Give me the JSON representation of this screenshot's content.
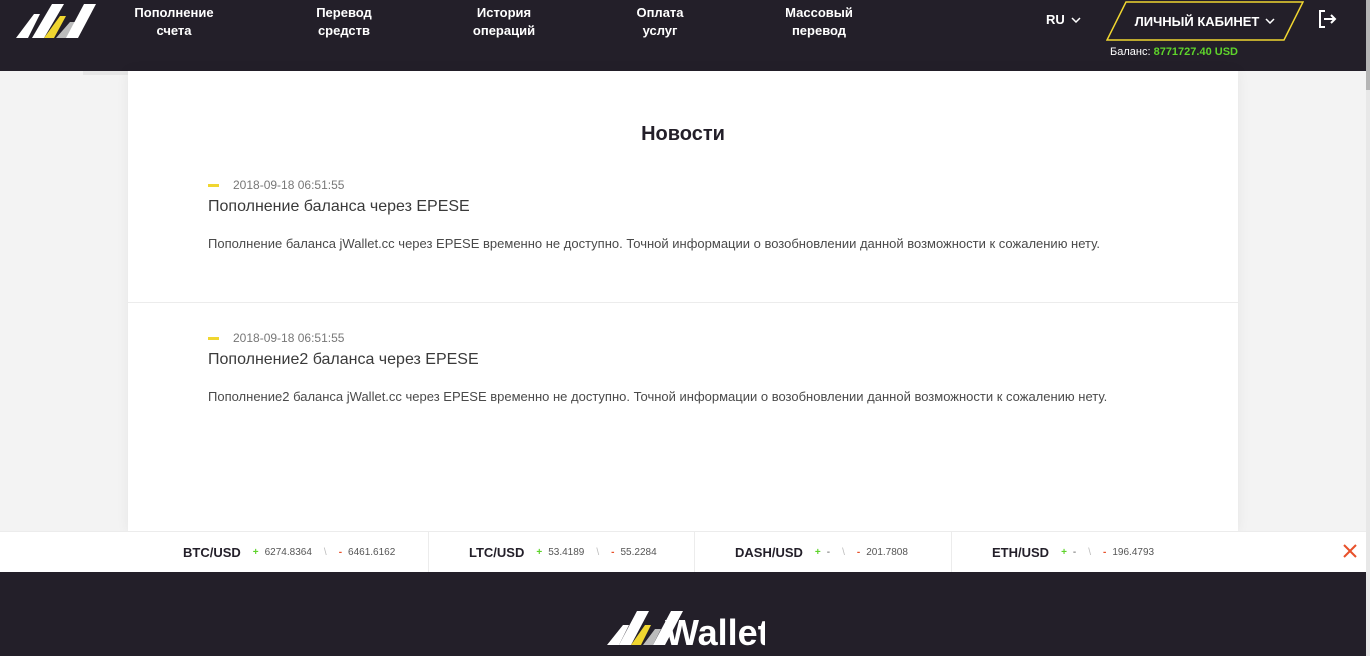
{
  "header": {
    "nav": [
      {
        "line1": "Пополнение",
        "line2": "счета"
      },
      {
        "line1": "Перевод",
        "line2": "средств"
      },
      {
        "line1": "История",
        "line2": "операций"
      },
      {
        "line1": "Оплата",
        "line2": "услуг"
      },
      {
        "line1": "Массовый",
        "line2": "перевод"
      }
    ],
    "language": "RU",
    "cabinet_label": "ЛИЧНЫЙ КАБИНЕТ",
    "balance_label": "Баланс:",
    "balance_amount": "8771727.40 USD"
  },
  "main": {
    "title": "Новости",
    "news": [
      {
        "date": "2018-09-18 06:51:55",
        "title": "Пополнение баланса через EPESE",
        "text": "Пополнение баланса jWallet.cc через EPESE временно не доступно. Точной информации о возобновлении данной возможности к сожалению нету."
      },
      {
        "date": "2018-09-18 06:51:55",
        "title": "Пополнение2 баланса через EPESE",
        "text": "Пополнение2 баланса jWallet.cc через EPESE временно не доступно. Точной информации о возобновлении данной возможности к сожалению нету."
      }
    ]
  },
  "ticker": [
    {
      "pair": "BTC/USD",
      "buy": "6274.8364",
      "sell": "6461.6162"
    },
    {
      "pair": "LTC/USD",
      "buy": "53.4189",
      "sell": "55.2284"
    },
    {
      "pair": "DASH/USD",
      "buy": "-",
      "sell": "201.7808"
    },
    {
      "pair": "ETH/USD",
      "buy": "-",
      "sell": "196.4793"
    }
  ],
  "colors": {
    "dark": "#231f29",
    "accent_yellow": "#f0d630",
    "balance_green": "#5ed32b",
    "close_red": "#e8512b"
  },
  "footer": {
    "logo_text": "JWallet"
  }
}
